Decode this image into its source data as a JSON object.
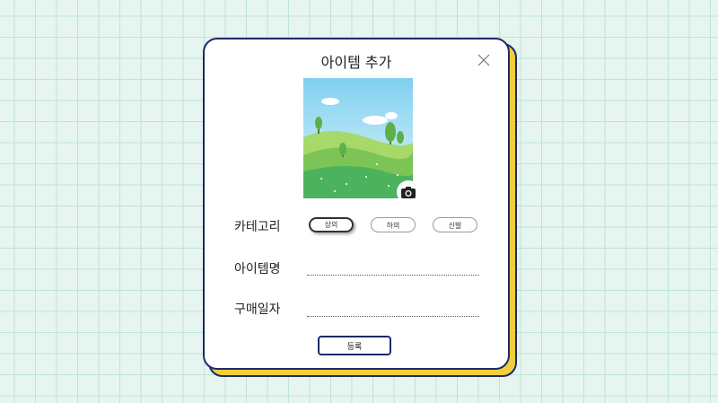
{
  "dialog": {
    "title": "아이템 추가",
    "close_icon": "close-icon",
    "camera_icon": "camera-icon",
    "category_label": "카테고리",
    "categories": [
      {
        "label": "상의",
        "selected": true
      },
      {
        "label": "하의",
        "selected": false
      },
      {
        "label": "신발",
        "selected": false
      }
    ],
    "item_name_label": "아이템명",
    "item_name_value": "",
    "purchase_date_label": "구매일자",
    "purchase_date_value": "",
    "submit_label": "등록"
  },
  "colors": {
    "border": "#1c2a6b",
    "card_shadow": "#f2cf3a",
    "grid_background": "#e6f5ef"
  }
}
